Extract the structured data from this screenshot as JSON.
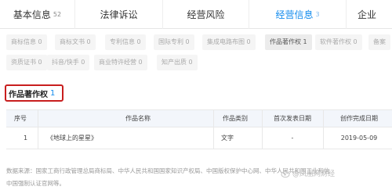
{
  "tabs": [
    {
      "label": "基本信息",
      "count": "52"
    },
    {
      "label": "法律诉讼",
      "count": ""
    },
    {
      "label": "经营风险",
      "count": ""
    },
    {
      "label": "经营信息",
      "count": "3"
    },
    {
      "label": "企业",
      "count": ""
    }
  ],
  "subtabs": [
    "商标信息 0",
    "商标文书 0",
    "专利信息 0",
    "国际专利 0",
    "集成电路布图 0",
    "作品著作权 1",
    "软件著作权 0",
    "备案",
    "资质证书 0",
    "抖音/快手 0",
    "商业特许经营 0",
    "知产出质 0"
  ],
  "section": {
    "title": "作品著作权",
    "count": "1"
  },
  "table": {
    "headers": [
      "序号",
      "作品名称",
      "作品类别",
      "首次发表日期",
      "创作完成日期"
    ],
    "rows": [
      [
        "1",
        "《地球上的星星》",
        "文字",
        "-",
        "2019-05-09"
      ]
    ]
  },
  "footer": {
    "line1": "数据来源：国家工商行政管理总局商标局、中华人民共和国国家知识产权局、中国版权保护中心网、中华人民共和国工业和信",
    "line2": "中国强制认证官网等。"
  },
  "watermark": "@凤凰网财经",
  "colors": {
    "accent": "#128bed",
    "highlight": "#c81e1e"
  }
}
